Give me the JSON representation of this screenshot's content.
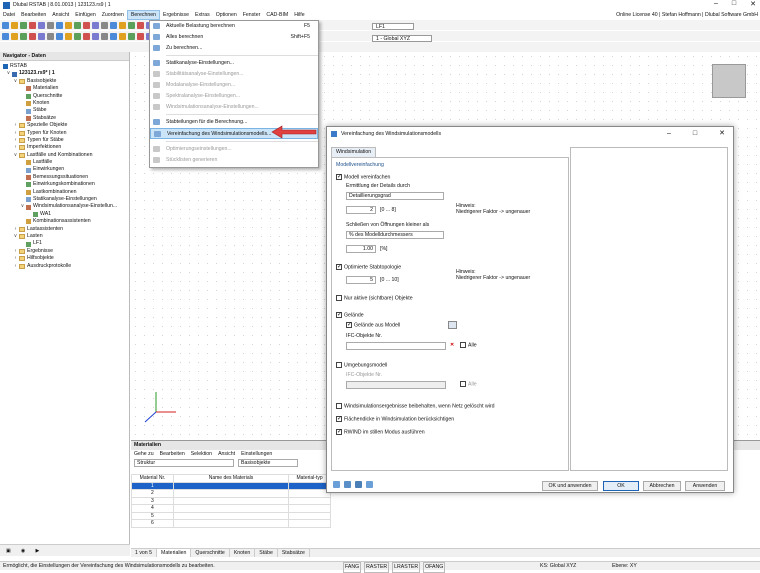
{
  "window": {
    "title": "Dlubal RSTAB | 8.01.0013 | 123123.rs9 | 1",
    "license": "Online License 40 | Stefan Hoffmann | Dlubal Software GmbH"
  },
  "menu": [
    "Datei",
    "Bearbeiten",
    "Ansicht",
    "Einfügen",
    "Zuordnen",
    "Berechnen",
    "Ergebnisse",
    "Extras",
    "Optionen",
    "Fenster",
    "CAD-BIM",
    "Hilfe"
  ],
  "toolbar": {
    "lf_label": "LF1",
    "coord": "1 - Global XYZ"
  },
  "navigator": {
    "title": "Navigator - Daten",
    "root": "RSTAB",
    "model": "123123.rs9* | 1",
    "items": [
      "Basisobjekte",
      "Materialien",
      "Querschnitte",
      "Knoten",
      "Stäbe",
      "Stabsätze",
      "Spezielle Objekte",
      "Typen für Knoten",
      "Typen für Stäbe",
      "Imperfektionen",
      "Lastfälle und Kombinationen",
      "Lastfälle",
      "Einwirkungen",
      "Bemessungssituationen",
      "Einwirkungskombinationen",
      "Lastkombinationen",
      "Statikanalyse-Einstellungen",
      "Windsimulationsanalyse-Einstellun...",
      "WA1",
      "Kombinationsassistenten",
      "Lastassistenten",
      "Lasten",
      "LF1",
      "Ergebnisse",
      "Hilfsobjekte",
      "Ausdruckprotokolle"
    ]
  },
  "dropdown": {
    "items": [
      {
        "label": "Aktuelle Belastung berechnen",
        "key": "F5",
        "dis": false
      },
      {
        "label": "Alles berechnen",
        "key": "Shift+F5",
        "dis": false
      },
      {
        "label": "Zu berechnen...",
        "key": "",
        "dis": false
      },
      {
        "label": "Statikanalyse-Einstellungen...",
        "key": "",
        "dis": false
      },
      {
        "label": "Stabilitätsanalyse-Einstellungen...",
        "key": "",
        "dis": true
      },
      {
        "label": "Modalanalyse-Einstellungen...",
        "key": "",
        "dis": true
      },
      {
        "label": "Spektralanalyse-Einstellungen...",
        "key": "",
        "dis": true
      },
      {
        "label": "Windsimulationsanalyse-Einstellungen...",
        "key": "",
        "dis": true
      },
      {
        "label": "Stabteilungen für die Berechnung...",
        "key": "",
        "dis": false
      },
      {
        "label": "Vereinfachung des Windsimulationsmodells...",
        "key": "",
        "dis": false
      },
      {
        "label": "Optimierungseinstellungen...",
        "key": "",
        "dis": true
      },
      {
        "label": "Stücklisten generieren",
        "key": "",
        "dis": true
      }
    ]
  },
  "dialog": {
    "title": "Vereinfachung des Windsimulationsmodells",
    "tab": "Windsimulation",
    "section": "Modellvereinfachung",
    "simplify": "Modell vereinfachen",
    "detail_label": "Ermittlung der Details durch",
    "detail_value": "Detaillierungsgrad",
    "detail_num": "2",
    "detail_range": "[0 ... 8]",
    "hint1_title": "Hinweis:",
    "hint1_text": "Niedrigerer Faktor -> ungenauer",
    "openings_label": "Schließen von Öffnungen kleiner als",
    "openings_value": "% des Modelldurchmessers",
    "openings_num": "1.00",
    "openings_unit": "[%]",
    "optimized": "Optimierte Stabtopologie",
    "opt_num": "5",
    "opt_range": "[0 ... 10]",
    "hint2_title": "Hinweis:",
    "hint2_text": "Niedrigerer Faktor -> ungenauer",
    "active_only": "Nur aktive (sichtbare) Objekte",
    "terrain": "Gelände",
    "terrain_from_model": "Gelände aus Modell",
    "ifc1": "IFC-Objekte Nr.",
    "alle1": "Alle",
    "surroundings": "Umgebungsmodell",
    "ifc2": "IFC-Objekte Nr.",
    "alle2": "Alle",
    "keep_results": "Windsimulationsergebnisse beibehalten, wenn Netz gelöscht wird",
    "thickness": "Flächendicke in Windsimulation berücksichtigen",
    "silent": "RWIND im stillen Modus ausführen",
    "ok_apply": "OK und anwenden",
    "ok": "OK",
    "cancel": "Abbrechen",
    "apply": "Anwenden"
  },
  "bottom": {
    "title": "Materialien",
    "menu": [
      "Gehe zu",
      "Bearbeiten",
      "Selektion",
      "Ansicht",
      "Einstellungen"
    ],
    "combo": "Struktur",
    "combo2": "Basisobjekte",
    "headers": [
      "Material Nr.",
      "Name des Materials",
      "Material-typ"
    ],
    "rows": [
      "1",
      "2",
      "3",
      "4",
      "5",
      "6"
    ],
    "pager": "1 von 5",
    "tabs": [
      "Materialien",
      "Querschnitte",
      "Knoten",
      "Stäbe",
      "Stabsätze"
    ]
  },
  "status": {
    "text": "Ermöglicht, die Einstellungen der Vereinfachung des Windsimulationsmodells zu bearbeiten.",
    "snaps": [
      "FANG",
      "RASTER",
      "LRASTER",
      "OFANG"
    ],
    "ks": "KS: Global XYZ",
    "plane": "Ebene: XY"
  }
}
